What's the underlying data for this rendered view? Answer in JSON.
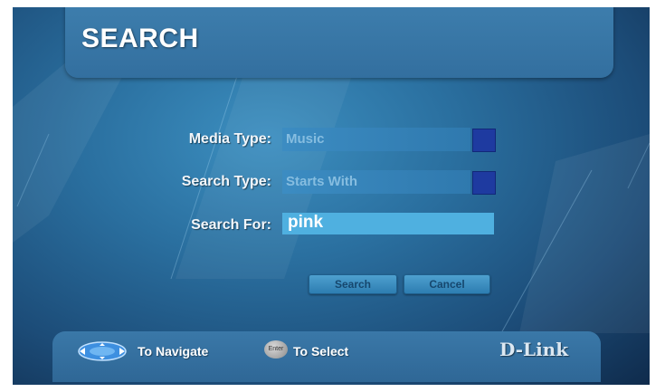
{
  "header": {
    "title": "SEARCH"
  },
  "form": {
    "media_type": {
      "label": "Media Type:",
      "value": "Music"
    },
    "search_type": {
      "label": "Search Type:",
      "value": "Starts With"
    },
    "search_for": {
      "label": "Search For:",
      "value": "pink"
    }
  },
  "buttons": {
    "search": "Search",
    "cancel": "Cancel"
  },
  "footer": {
    "navigate_hint": "To Navigate",
    "select_hint": "To Select",
    "enter_key": "Enter",
    "brand": "D-Link",
    "icons": {
      "navigate": "directional-pad-icon",
      "select": "enter-key-icon"
    }
  },
  "colors": {
    "background": "#2a6f9f",
    "field_bg": "#3c8cc2",
    "field_text": "#86bde0",
    "dropdown_button": "#1e3aa0",
    "input_bg": "#4fb0e0"
  }
}
